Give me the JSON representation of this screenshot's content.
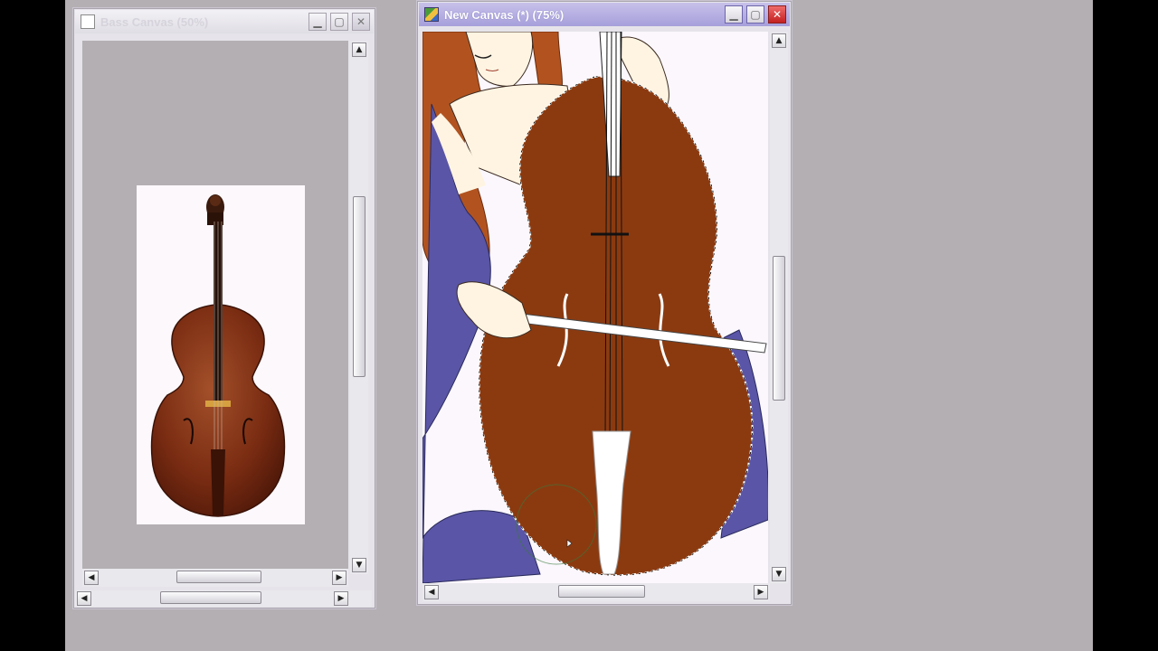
{
  "windows": {
    "reference": {
      "title": "Bass Canvas (50%)",
      "active": false
    },
    "main": {
      "title": "New Canvas (*) (75%)",
      "active": true
    }
  },
  "colors": {
    "workspace_bg": "#b3afb3",
    "active_titlebar": "#a69fdb",
    "cello_body": "#8b3a10",
    "dress": "#5a55a6",
    "hair": "#b2531f",
    "skin": "#fff4e2"
  },
  "icons": {
    "minimize": "minimize-icon",
    "maximize": "maximize-icon",
    "close": "close-icon",
    "scroll_up": "arrow-up-icon",
    "scroll_down": "arrow-down-icon",
    "scroll_left": "arrow-left-icon",
    "scroll_right": "arrow-right-icon"
  },
  "scroll": {
    "reference_vertical_position": 0.55,
    "reference_horizontal_position": 0.5,
    "main_vertical_position": 0.6,
    "main_horizontal_position": 0.5
  },
  "glyphs": {
    "minimize": "▁",
    "maximize": "▢",
    "close": "✕",
    "up": "▲",
    "down": "▼",
    "left": "◀",
    "right": "▶"
  }
}
